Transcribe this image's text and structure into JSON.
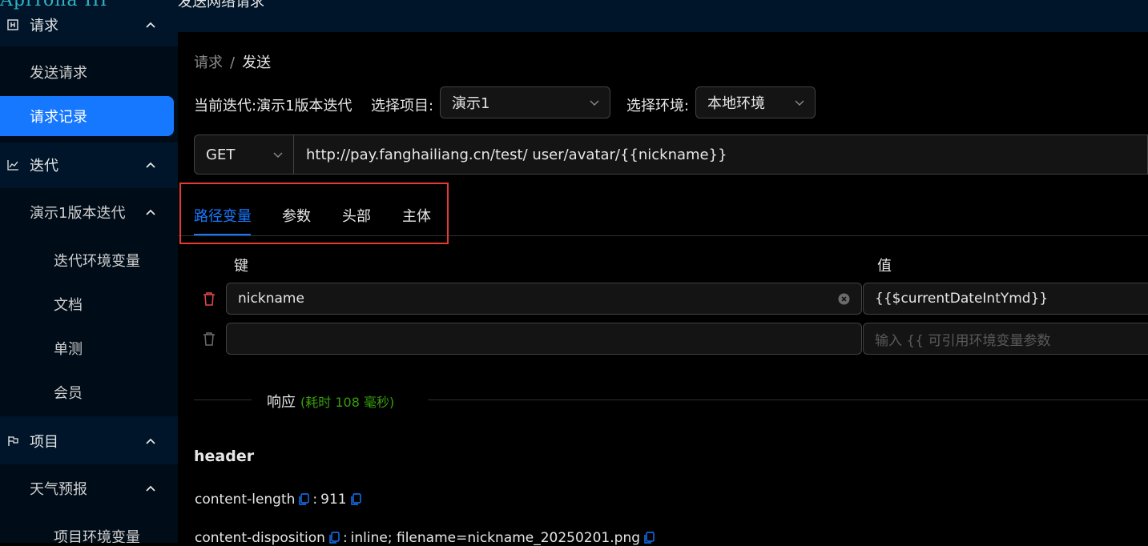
{
  "sidebar": {
    "logo_text": "ApiTona III",
    "groups": [
      {
        "label": "请求",
        "icon": "request-icon"
      },
      {
        "label": "迭代",
        "icon": "line-chart-icon"
      },
      {
        "label": "项目",
        "icon": "flag-icon"
      }
    ],
    "request_items": [
      "发送请求",
      "请求记录"
    ],
    "iteration_sub": "演示1版本迭代",
    "iteration_items": [
      "迭代环境变量",
      "文档",
      "单测",
      "会员"
    ],
    "project_sub": "天气预报",
    "project_items": [
      "项目环境变量"
    ]
  },
  "header": {
    "title": "发送网络请求"
  },
  "breadcrumb": {
    "parent": "请求",
    "separator": "/",
    "current": "发送"
  },
  "toolbar": {
    "iteration_label": "当前迭代:",
    "iteration_value": "演示1版本迭代",
    "project_label": "选择项目:",
    "project_value": "演示1",
    "env_label": "选择环境:",
    "env_value": "本地环境"
  },
  "request": {
    "method": "GET",
    "url": "http://pay.fanghailiang.cn/test/ user/avatar/{{nickname}}"
  },
  "tabs": [
    {
      "label": "路径变量",
      "active": true
    },
    {
      "label": "参数",
      "active": false
    },
    {
      "label": "头部",
      "active": false
    },
    {
      "label": "主体",
      "active": false
    }
  ],
  "path_vars": {
    "key_header": "键",
    "value_header": "值",
    "rows": [
      {
        "key": "nickname",
        "value": "{{$currentDateIntYmd}}"
      }
    ],
    "value_placeholder": "输入 {{ 可引用环境变量参数"
  },
  "response": {
    "title": "响应",
    "cost": "(耗时 108 毫秒)",
    "header_title": "header",
    "headers": [
      {
        "name": "content-length",
        "value": "911"
      },
      {
        "name": "content-disposition",
        "value": "inline; filename=nickname_20250201.png"
      }
    ]
  },
  "colors": {
    "sidebar_bg": "#001529",
    "accent": "#1677ff",
    "highlight_box": "#e53935",
    "success": "#389e0d",
    "delete_red": "#e5484d"
  }
}
